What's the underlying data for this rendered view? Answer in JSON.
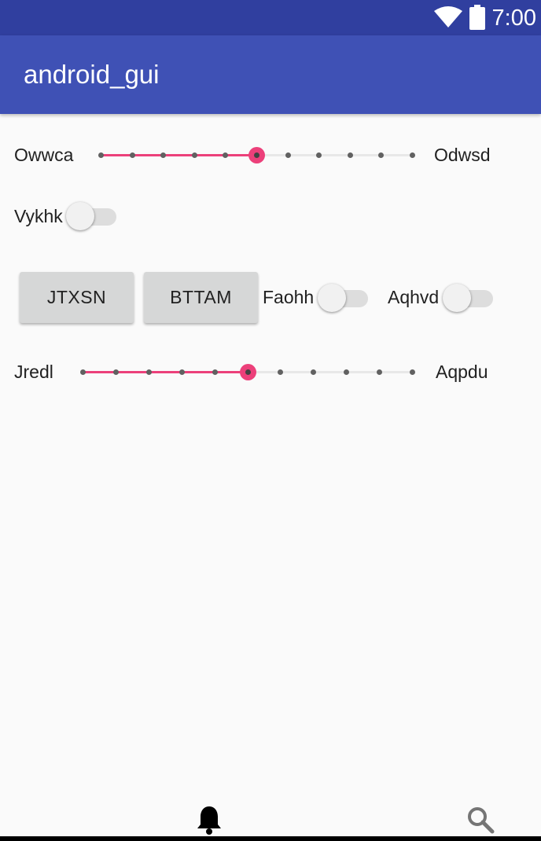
{
  "status_bar": {
    "time": "7:00",
    "icons": [
      "wifi-icon",
      "battery-icon"
    ]
  },
  "app_bar": {
    "title": "android_gui"
  },
  "slider1": {
    "label_left": "Owwca",
    "label_right": "Odwsd",
    "steps": 10,
    "value": 5
  },
  "switch1": {
    "label": "Vykhk",
    "checked": false
  },
  "buttons": {
    "button1": "JTXSN",
    "button2": "BTTAM"
  },
  "switch2": {
    "label": "Faohh",
    "checked": false
  },
  "switch3": {
    "label": "Aqhvd",
    "checked": false
  },
  "slider2": {
    "label_left": "Jredl",
    "label_right": "Aqpdu",
    "steps": 10,
    "value": 5
  },
  "bottom_nav": {
    "icons": [
      "bell-icon",
      "search-icon"
    ]
  },
  "colors": {
    "status_bar": "#303f9f",
    "app_bar": "#3f51b5",
    "accent": "#ec407a",
    "background": "#fafafa"
  }
}
